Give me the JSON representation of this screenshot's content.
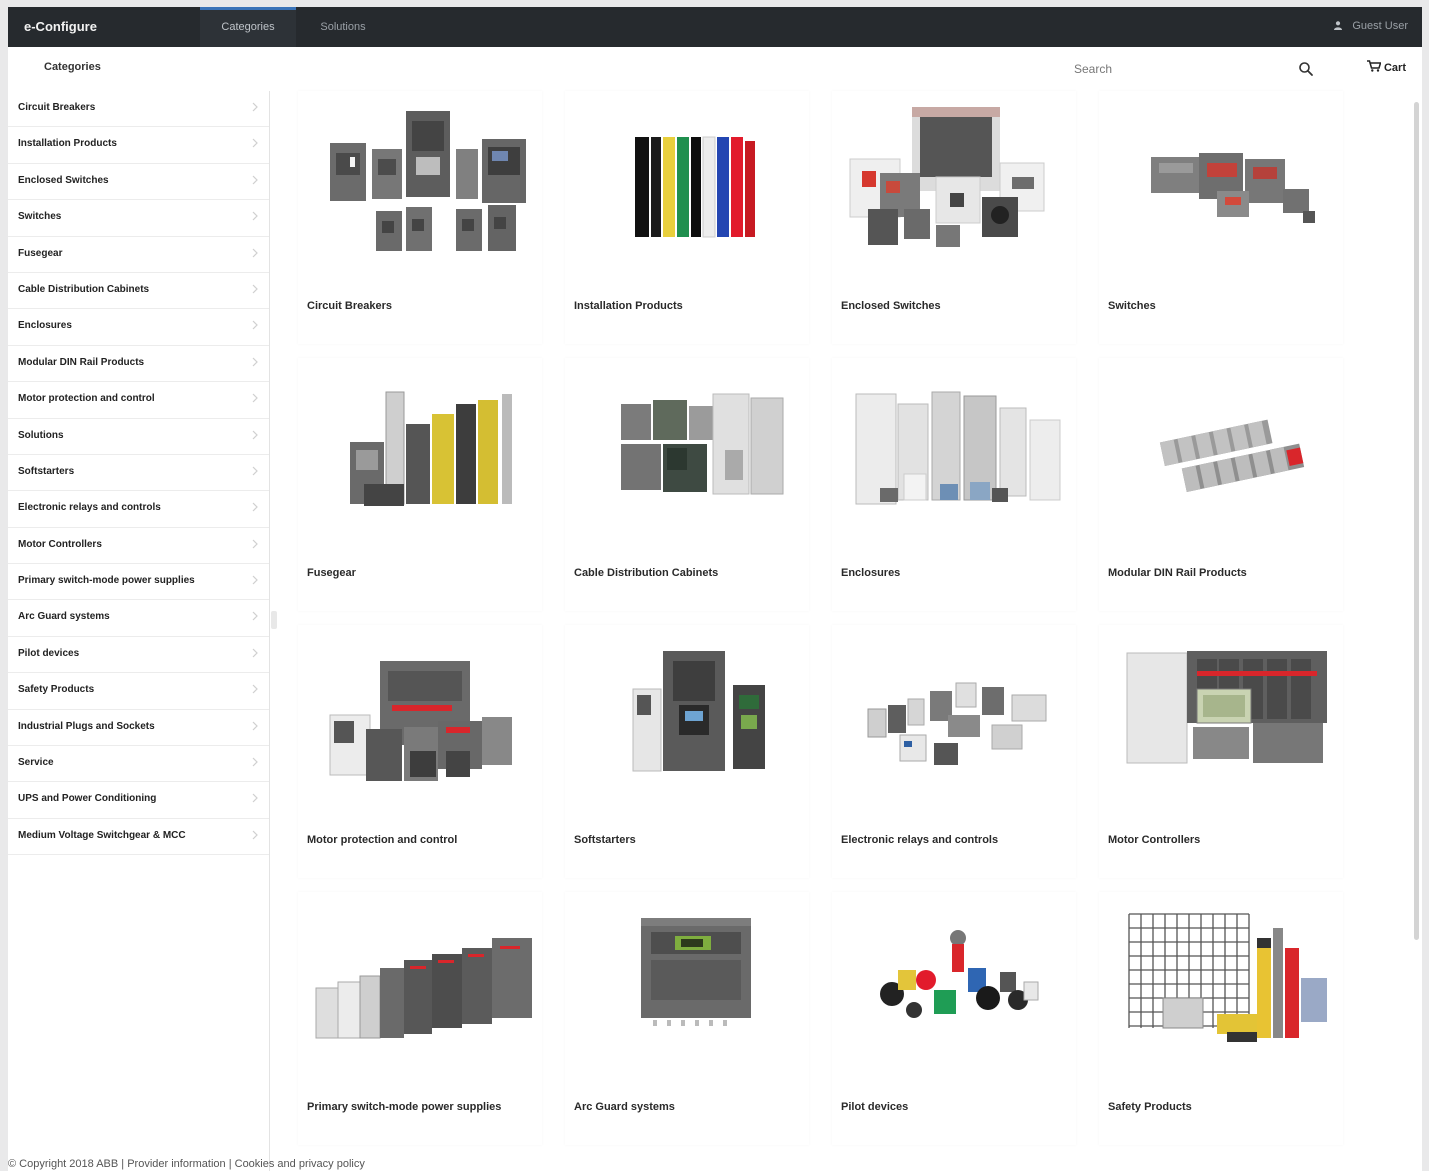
{
  "app": {
    "brand": "e-Configure",
    "tabs": [
      "Categories",
      "Solutions"
    ],
    "user": "Guest User"
  },
  "subheader": {
    "heading": "Categories",
    "search_placeholder": "Search",
    "cart_label": "Cart"
  },
  "sidebar": {
    "items": [
      "Circuit Breakers",
      "Installation Products",
      "Enclosed Switches",
      "Switches",
      "Fusegear",
      "Cable Distribution Cabinets",
      "Enclosures",
      "Modular DIN Rail Products",
      "Motor protection and control",
      "Solutions",
      "Softstarters",
      "Electronic relays and controls",
      "Motor Controllers",
      "Primary switch-mode power supplies",
      "Arc Guard systems",
      "Pilot devices",
      "Safety Products",
      "Industrial Plugs and Sockets",
      "Service",
      "UPS and Power Conditioning",
      "Medium Voltage Switchgear & MCC"
    ]
  },
  "cards": [
    "Circuit Breakers",
    "Installation Products",
    "Enclosed Switches",
    "Switches",
    "Fusegear",
    "Cable Distribution Cabinets",
    "Enclosures",
    "Modular DIN Rail Products",
    "Motor protection and control",
    "Softstarters",
    "Electronic relays and controls",
    "Motor Controllers",
    "Primary switch-mode power supplies",
    "Arc Guard systems",
    "Pilot devices",
    "Safety Products"
  ],
  "footer": {
    "copyright": "© Copyright 2018 ABB |",
    "provider": "Provider information",
    "sep": "|",
    "cookies": "Cookies and privacy policy"
  },
  "icons": {
    "search": "search-icon",
    "cart": "cart-icon",
    "user": "user-icon",
    "chevron": "chevron-right-icon"
  },
  "colors": {
    "topbar": "#262a2e",
    "tab_accent": "#3a73b8",
    "abb_red": "#d9262b"
  }
}
